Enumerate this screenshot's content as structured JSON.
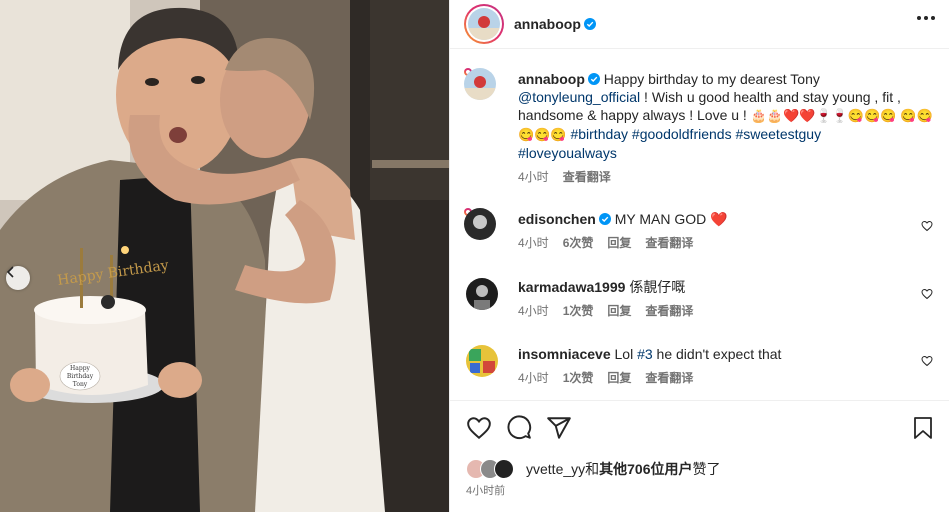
{
  "post": {
    "author": "annaboop",
    "more_icon": "more-horizontal-icon",
    "caption": {
      "username": "annaboop",
      "text_1": "Happy birthday to my dearest Tony",
      "mention": "@tonyleung_official",
      "text_2": "! Wish u good health and stay young , fit , handsome & happy always ! Love u !",
      "emojis_1": "🎂🎂❤️❤️🍷🍷😋😋😋",
      "emojis_2": "😋😋😋😋😋",
      "hashtags_1": "#birthday #goodoldfriends #sweetestguy",
      "hashtags_2": "#loveyoualways",
      "time": "4小时",
      "translate": "查看翻译"
    },
    "comments": [
      {
        "username": "edisonchen",
        "verified": true,
        "text": "MY MAN GOD",
        "emoji": "❤️",
        "time": "4小时",
        "likes": "6次赞",
        "reply": "回复",
        "translate": "查看翻译"
      },
      {
        "username": "karmadawa1999",
        "verified": false,
        "text": "係靚仔嘅",
        "time": "4小时",
        "likes": "1次赞",
        "reply": "回复",
        "translate": "查看翻译"
      },
      {
        "username": "insomniaceve",
        "verified": false,
        "text_a": "Lol ",
        "tag": "#3",
        "text_b": " he didn't expect that",
        "time": "4小时",
        "likes": "1次赞",
        "reply": "回复",
        "translate": "查看翻译"
      }
    ],
    "likes": {
      "first_user": "yvette_yy",
      "joiner": "和",
      "others": "其他706位用户",
      "suffix": "赞了"
    },
    "timestamp": "4小时前",
    "photo": {
      "cake_topper": "Happy Birthday",
      "cake_plaque_1": "Happy",
      "cake_plaque_2": "Birthday",
      "cake_plaque_3": "Tony"
    }
  },
  "colors": {
    "heart": "#ed4956",
    "verified": "#0095f6",
    "link": "#00376b",
    "muted": "#737373"
  }
}
